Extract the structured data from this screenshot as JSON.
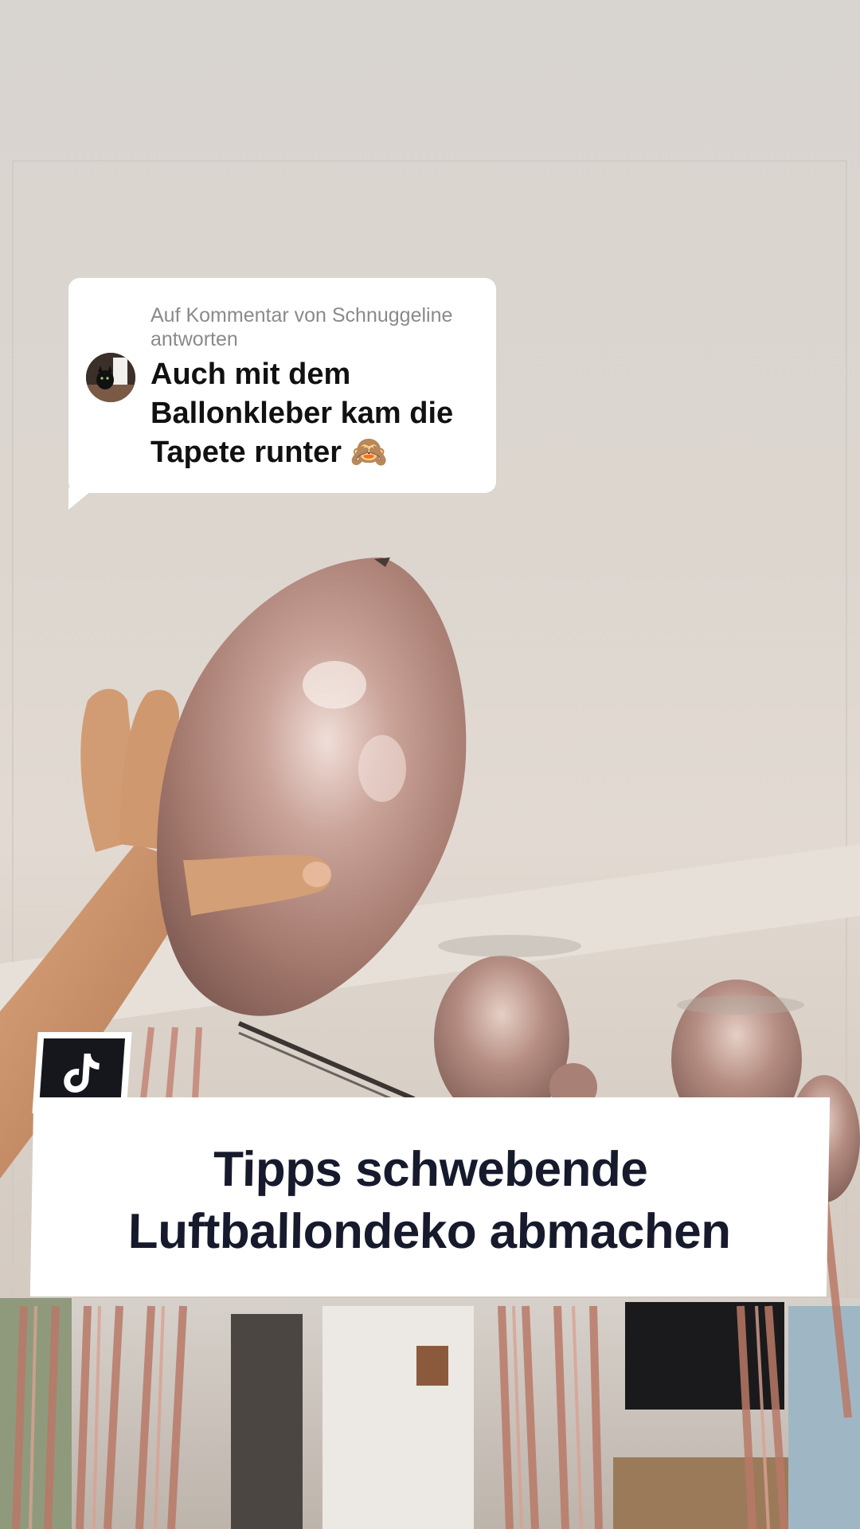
{
  "reply": {
    "header": "Auf Kommentar von Schnuggeline antworten",
    "text": "Auch mit dem Ballonkleber kam die Tapete runter 🙈"
  },
  "title": {
    "line1": "Tipps schwebende",
    "line2": "Luftballondeko abmachen"
  },
  "icons": {
    "badge": "tiktok-logo-icon",
    "avatar": "commenter-avatar"
  },
  "colors": {
    "title_text": "#161a2c",
    "badge_bg": "#15171c",
    "balloon": "#b89186"
  }
}
